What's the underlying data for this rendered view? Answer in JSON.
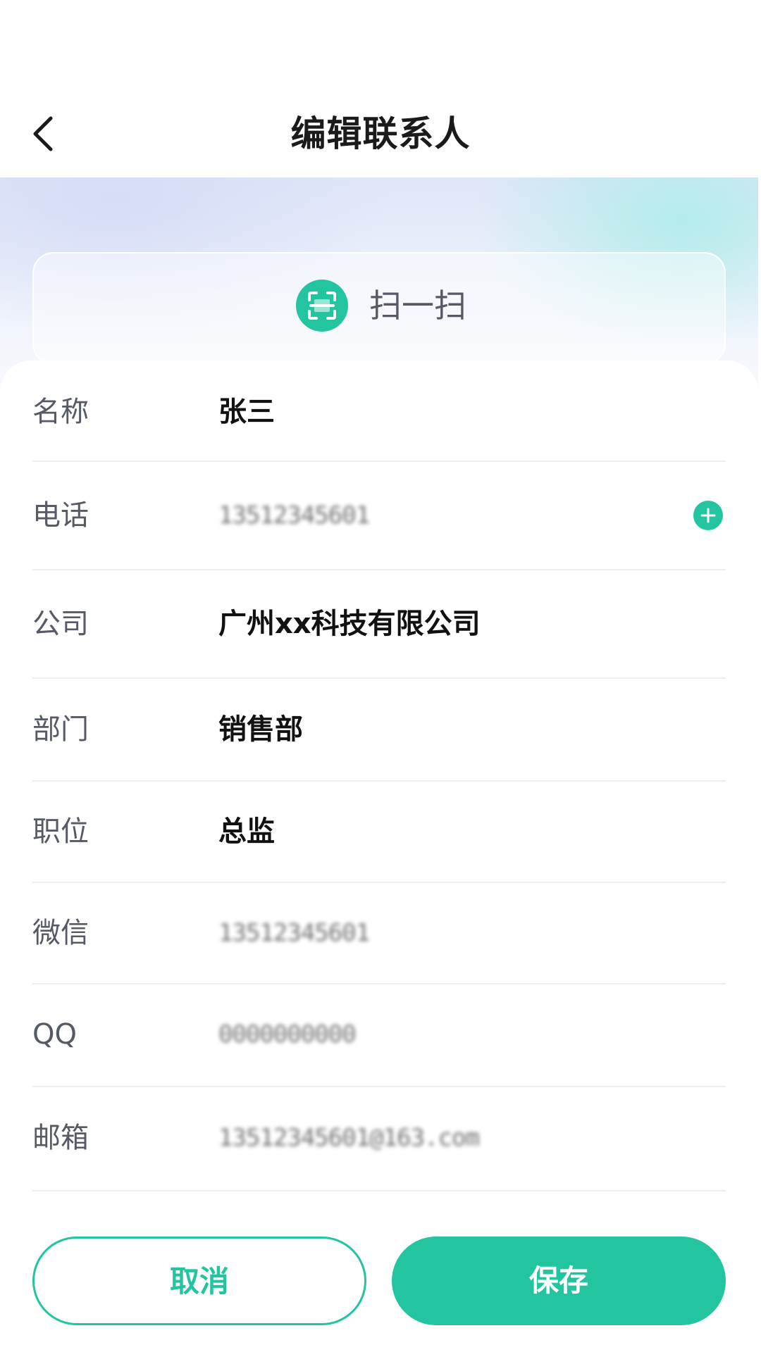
{
  "header": {
    "title": "编辑联系人"
  },
  "scan": {
    "label": "扫一扫"
  },
  "form": {
    "rows": [
      {
        "label": "名称",
        "value": "张三"
      },
      {
        "label": "电话",
        "value": "13512345601"
      },
      {
        "label": "公司",
        "value": "广州xx科技有限公司"
      },
      {
        "label": "部门",
        "value": "销售部"
      },
      {
        "label": "职位",
        "value": "总监"
      },
      {
        "label": "微信",
        "value": "13512345601"
      },
      {
        "label": "QQ",
        "value": "0000000000"
      },
      {
        "label": "邮箱",
        "value": "13512345601@163.com"
      }
    ]
  },
  "actions": {
    "cancel_label": "取消",
    "save_label": "保存"
  },
  "colors": {
    "accent": "#22c59f",
    "label_text": "#555a66",
    "value_text": "#111111"
  },
  "icons": {
    "back": "chevron-left-icon",
    "scan": "scan-icon",
    "add": "plus-icon"
  }
}
